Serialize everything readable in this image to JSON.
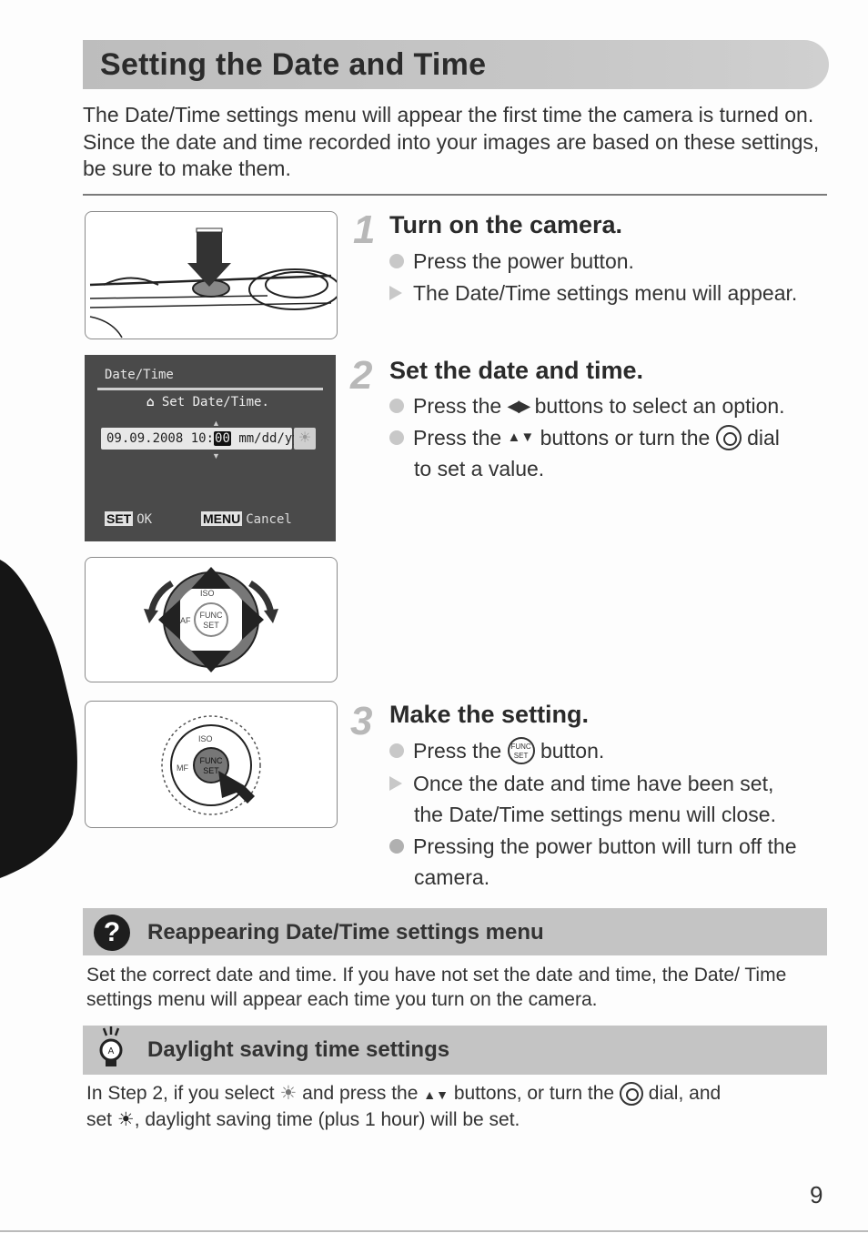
{
  "page": {
    "title": "Setting the Date and Time",
    "intro": "The Date/Time settings menu will appear the first time the camera is turned on. Since the date and time recorded into your images are based on these settings, be sure to make them.",
    "page_number": "9"
  },
  "camera_screen": {
    "title": "Date/Time",
    "prompt": "Set Date/Time.",
    "date_value": "09.09.2008 10:",
    "selected_value": "00",
    "format": "mm/dd/yy",
    "ok_key": "SET",
    "ok_label": "OK",
    "cancel_key": "MENU",
    "cancel_label": "Cancel"
  },
  "dial": {
    "top_label": "ISO",
    "center_label_1": "FUNC",
    "center_label_2": "SET",
    "left_label_manual": "MF",
    "left_label_af": "AF"
  },
  "steps": [
    {
      "number": "1",
      "title": "Turn on the camera.",
      "bullets": [
        {
          "type": "action",
          "text": "Press the power button."
        },
        {
          "type": "result",
          "text": "The Date/Time settings menu will appear."
        }
      ]
    },
    {
      "number": "2",
      "title": "Set the date and time.",
      "bullets": [
        {
          "type": "action",
          "pre": "Press the",
          "icon": "left-right-arrows",
          "post": "buttons to select an option."
        },
        {
          "type": "action",
          "pre": "Press the",
          "icon": "up-down-arrows",
          "mid": "buttons or turn the",
          "icon2": "control-dial",
          "post": "dial",
          "cont": "to set a value."
        }
      ]
    },
    {
      "number": "3",
      "title": "Make the setting.",
      "bullets": [
        {
          "type": "action",
          "pre": "Press the",
          "icon": "func-set-button",
          "post": "button."
        },
        {
          "type": "result",
          "text": "Once the date and time have been set,",
          "cont": "the Date/Time settings menu will close."
        },
        {
          "type": "note",
          "text": "Pressing the power button will turn off the",
          "cont": "camera."
        }
      ]
    }
  ],
  "notes": [
    {
      "icon": "question-icon",
      "title": "Reappearing Date/Time settings menu",
      "text": "Set the correct date and time. If you have not set the date and time, the Date/ Time settings menu will appear each time you turn on the camera."
    },
    {
      "icon": "tip-lightbulb-icon",
      "title": "Daylight saving time settings",
      "line1_a": "In Step 2, if you select",
      "line1_b": "and press the",
      "line1_c": "buttons, or turn the",
      "line1_d": "dial, and",
      "line2_a": "set",
      "line2_b": ", daylight saving time (plus 1 hour) will be set."
    }
  ],
  "glyphs": {
    "left_right": "◀▶",
    "up_down": "▲▼",
    "sun": "☀",
    "home": "⌂",
    "question": "?"
  }
}
